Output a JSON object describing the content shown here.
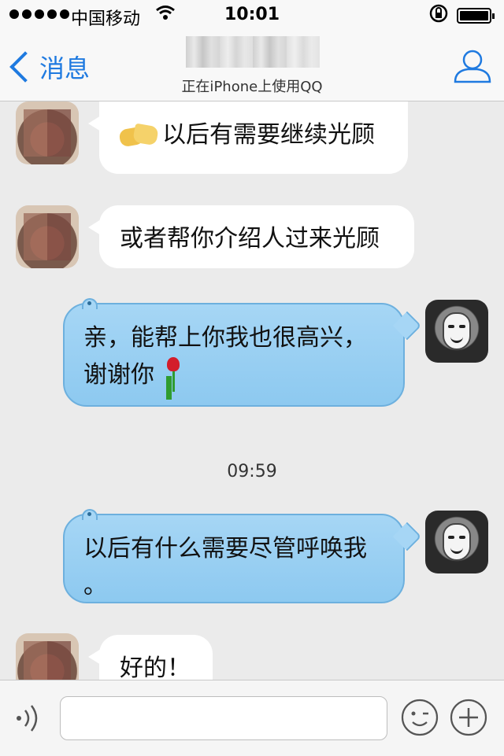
{
  "status_bar": {
    "carrier": "中国移动",
    "time": "10:01"
  },
  "nav": {
    "back_label": "消息",
    "subtitle": "正在iPhone上使用QQ"
  },
  "messages": [
    {
      "side": "left",
      "text": "以后有需要继续光顾",
      "emoji": "handshake"
    },
    {
      "side": "left",
      "text": "或者帮你介绍人过来光顾"
    },
    {
      "side": "right",
      "line1": "亲，能帮上你我也很高兴，",
      "line2": "谢谢你",
      "emoji": "rose"
    },
    {
      "side": "right",
      "line1": "以后有什么需要尽管呼唤我",
      "line2": "。"
    },
    {
      "side": "left",
      "text": "好的！"
    }
  ],
  "timestamp": "09:59",
  "input": {
    "placeholder": ""
  },
  "colors": {
    "accent": "#1f7ae0",
    "bubble_right": "#a6d6f5",
    "bubble_left": "#ffffff",
    "background": "#ebebeb"
  },
  "icons": [
    "signal-dots-icon",
    "wifi-icon",
    "rotation-lock-icon",
    "battery-icon",
    "back-chevron-icon",
    "profile-icon",
    "voice-icon",
    "emoji-face-icon",
    "plus-icon",
    "handshake-emoji",
    "rose-emoji"
  ]
}
